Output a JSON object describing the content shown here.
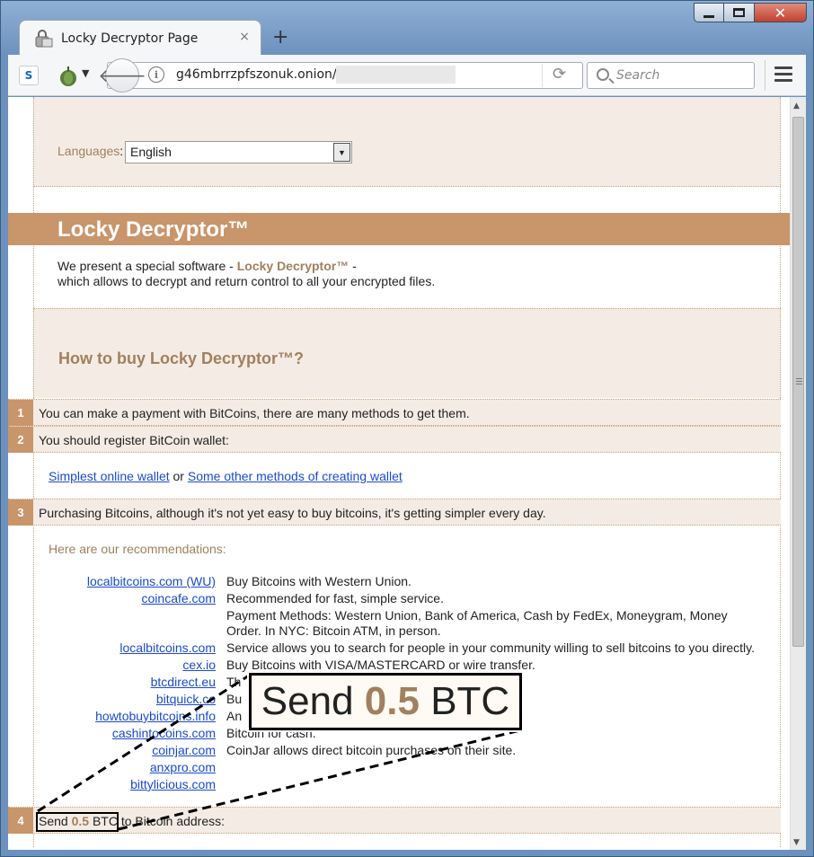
{
  "browser": {
    "tab_title": "Locky Decryptor Page",
    "tab_close": "×",
    "new_tab": "+",
    "url": "g46mbrrzpfszonuk.onion/",
    "search_placeholder": "Search"
  },
  "window": {
    "close_glyph": "✕"
  },
  "page": {
    "language_label": "Languages",
    "language_colon": ":",
    "language_value": "English",
    "title": "Locky Decryptor™",
    "intro_prefix": "We present a special software - ",
    "intro_brand": "Locky Decryptor™",
    "intro_suffix": " -",
    "intro_line2": "which allows to decrypt and return control to all your encrypted files.",
    "howto": "How to buy Locky Decryptor™?",
    "steps": [
      {
        "num": "1",
        "text": "You can make a payment with BitCoins, there are many methods to get them."
      },
      {
        "num": "2",
        "text": "You should register BitCoin wallet:"
      },
      {
        "num": "3",
        "text": "Purchasing Bitcoins, although it's not yet easy to buy bitcoins, it's getting simpler every day."
      },
      {
        "num": "4",
        "text_send": "Send",
        "text_amount": "0.5",
        "text_unit": "BTC",
        "text_rest": " to Bitcoin address:"
      }
    ],
    "wallet_link1": "Simplest online wallet",
    "wallet_or": " or ",
    "wallet_link2": "Some other methods of creating wallet",
    "recs_head": "Here are our recommendations:",
    "recommendations": [
      {
        "link": "localbitcoins.com (WU)",
        "desc": "Buy Bitcoins with Western Union."
      },
      {
        "link": "coincafe.com",
        "desc": "Recommended for fast, simple service."
      },
      {
        "link": "",
        "desc": "Payment Methods: Western Union, Bank of America, Cash by FedEx, Moneygram, Money Order. In NYC: Bitcoin ATM, in person."
      },
      {
        "link": "localbitcoins.com",
        "desc": "Service allows you to search for people in your community willing to sell bitcoins to you directly."
      },
      {
        "link": "cex.io",
        "desc": "Buy Bitcoins with VISA/MASTERCARD or wire transfer."
      },
      {
        "link": "btcdirect.eu",
        "desc": "Th"
      },
      {
        "link": "bitquick.co",
        "desc": "Bu"
      },
      {
        "link": "howtobuybitcoins.info",
        "desc": "An"
      },
      {
        "link": "cashintocoins.com",
        "desc": "Bitcoin for cash."
      },
      {
        "link": "coinjar.com",
        "desc": "CoinJar allows direct bitcoin purchases on their site."
      },
      {
        "link": "anxpro.com",
        "desc": ""
      },
      {
        "link": "bittylicious.com",
        "desc": ""
      }
    ],
    "callout": {
      "send": "Send",
      "amount": "0.5",
      "unit": "BTC"
    }
  },
  "colors": {
    "accent": "#c9956a",
    "brand_text": "#a0805f",
    "panel": "#f4ece4",
    "link": "#1a4acc"
  }
}
